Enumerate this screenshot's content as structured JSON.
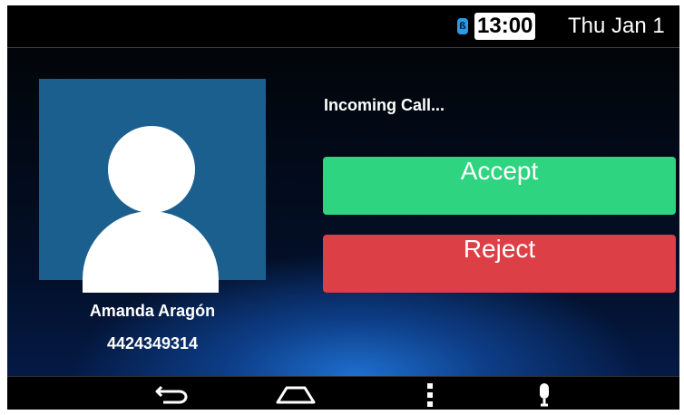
{
  "status_bar": {
    "bluetooth_icon": "bluetooth-icon",
    "time": "13:00",
    "date": "Thu Jan 1"
  },
  "call": {
    "status_text": "Incoming Call...",
    "caller_name": "Amanda Aragón",
    "caller_number": "4424349314",
    "avatar_icon": "person-icon",
    "accept_label": "Accept",
    "reject_label": "Reject"
  },
  "nav_bar": {
    "icons": [
      "back-icon",
      "home-icon",
      "menu-icon",
      "microphone-icon"
    ]
  },
  "colors": {
    "accept": "#2ed47f",
    "reject": "#dc3f45",
    "avatar_bg": "#1b5f8f",
    "bluetooth": "#2b9be8"
  }
}
